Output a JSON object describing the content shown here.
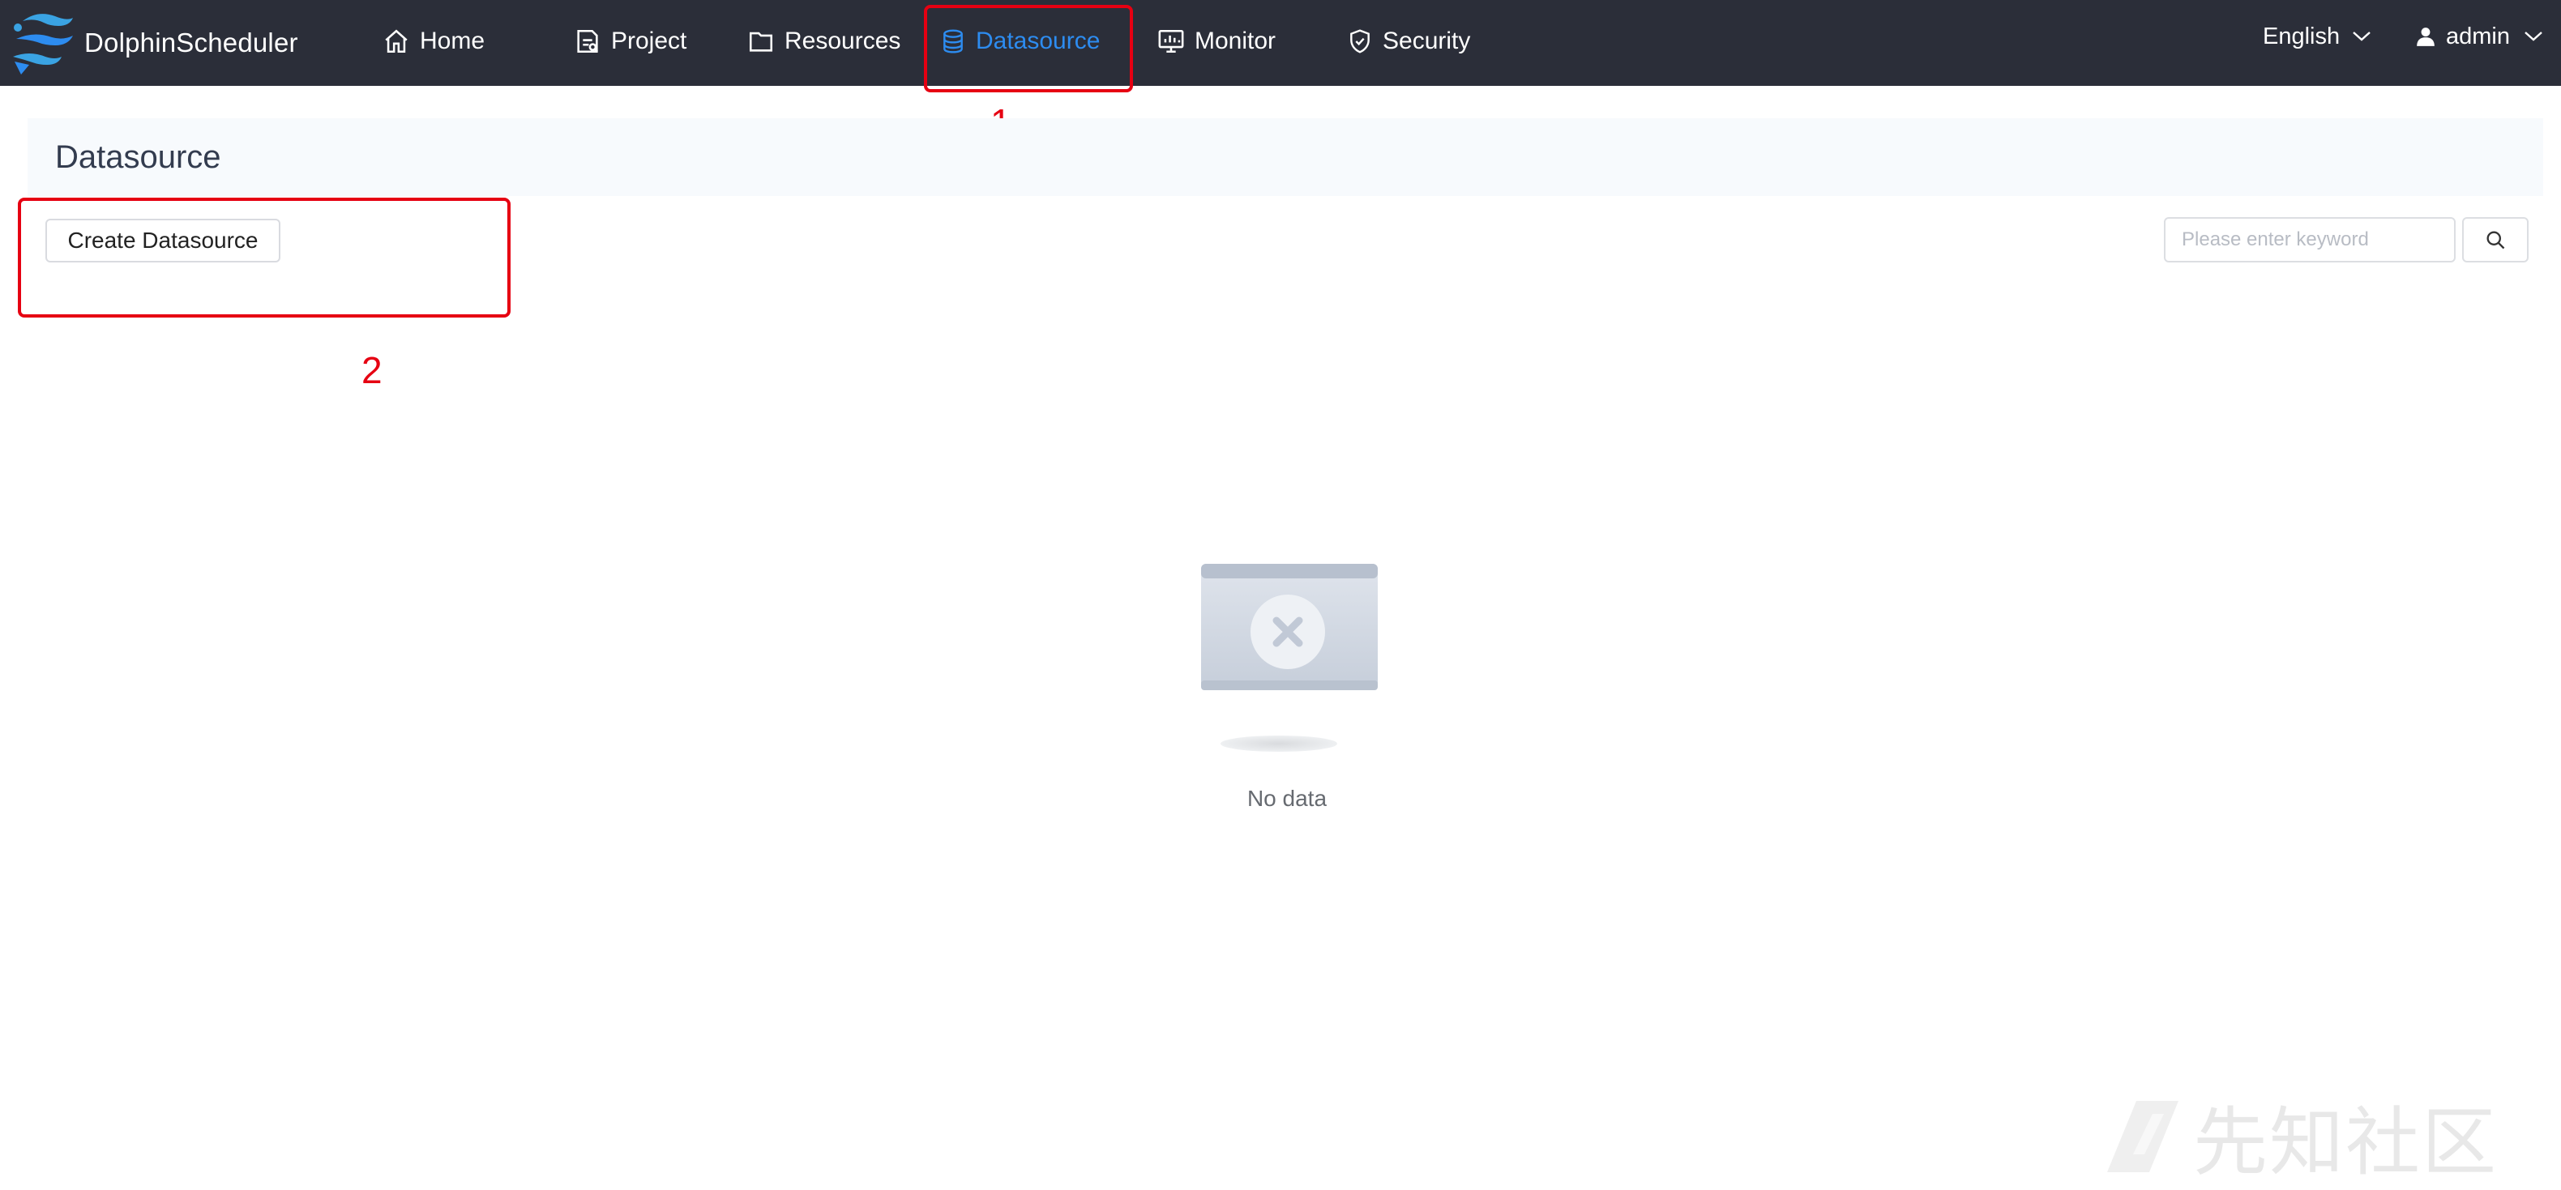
{
  "app": {
    "name": "DolphinScheduler"
  },
  "nav": {
    "items": [
      {
        "label": "Home",
        "icon": "home-icon"
      },
      {
        "label": "Project",
        "icon": "project-icon"
      },
      {
        "label": "Resources",
        "icon": "folder-icon"
      },
      {
        "label": "Datasource",
        "icon": "database-icon",
        "active": true
      },
      {
        "label": "Monitor",
        "icon": "monitor-icon"
      },
      {
        "label": "Security",
        "icon": "shield-icon"
      }
    ],
    "language": "English",
    "user": "admin"
  },
  "page": {
    "title": "Datasource"
  },
  "toolbar": {
    "create_label": "Create Datasource",
    "search_placeholder": "Please enter keyword"
  },
  "empty": {
    "text": "No data"
  },
  "annotations": [
    {
      "number": "1"
    },
    {
      "number": "2"
    }
  ],
  "watermark": {
    "text": "先知社区"
  },
  "colors": {
    "topbar": "#2b2e39",
    "active": "#2d8cf0",
    "annotation": "#e60012",
    "header_bg": "#f7fafd"
  }
}
